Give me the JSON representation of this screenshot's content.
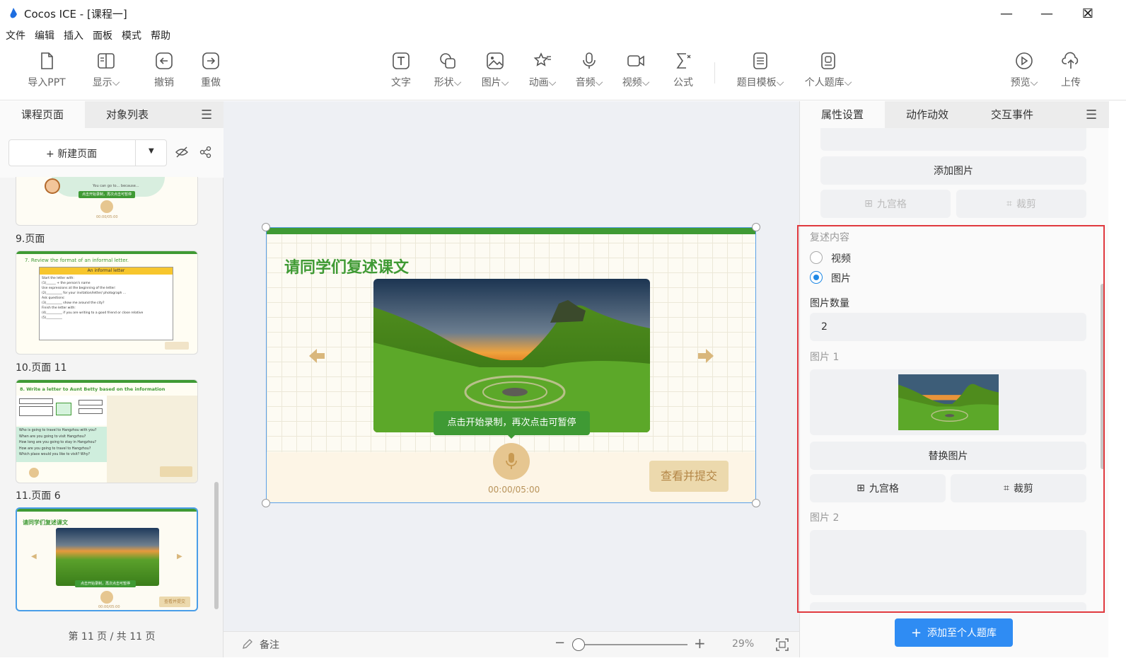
{
  "window": {
    "title": "Cocos ICE - [课程一]",
    "minimize": "—",
    "maximize": "☐",
    "close": "✕"
  },
  "menu": [
    "文件",
    "编辑",
    "插入",
    "面板",
    "模式",
    "帮助"
  ],
  "toolbar": {
    "import_ppt": "导入PPT",
    "display": "显示",
    "undo": "撤销",
    "redo": "重做",
    "text": "文字",
    "shape": "形状",
    "image": "图片",
    "animation": "动画",
    "audio": "音频",
    "video": "视频",
    "formula": "公式",
    "question_template": "题目模板",
    "personal_bank": "个人题库",
    "preview": "预览",
    "upload": "上传"
  },
  "left_panel": {
    "tabs": [
      "课程页面",
      "对象列表"
    ],
    "new_page": "新建页面",
    "pages": [
      {
        "label": "9.页面",
        "line1": "You can go to... because...",
        "rec_btn": "点击开始录制，再次点击可暂停",
        "time": "00:00/05:00"
      },
      {
        "label": "10.页面 11",
        "heading": "7. Review the format of an informal letter.",
        "box_title": "An informal letter",
        "lines": [
          "Start the letter with:",
          "Use expressions at the beginning of the letter:",
          "Ask questions:",
          "Finish the letter with:"
        ],
        "bullets": [
          "(1)______ + the person's name",
          "(2)__________ for your invitation/letter/ photograph ...",
          "(3)__________ show me around the city?",
          "(4)__________ if you are writing to a good friend or close relative",
          "(5)__________"
        ]
      },
      {
        "label": "11.页面 6",
        "heading": "8. Write a letter to Aunt Betty based on the information",
        "questions": [
          "Who is going to travel to Hangzhou with you?",
          "When are you going to visit Hangzhou?",
          "How long are you going to stay in Hangzhou?",
          "How are you going to travel to Hangzhou?",
          "Which place would you like to visit? Why?"
        ]
      },
      {
        "label": "",
        "title": "请同学们复述课文",
        "rec_btn": "点击开始录制，再次点击可暂停",
        "time": "00:00/05:00",
        "submit": "查看并提交"
      }
    ],
    "pagination": "第 11 页 / 共 11 页"
  },
  "slide": {
    "title": "请同学们复述课文",
    "record_tip": "点击开始录制，再次点击可暂停",
    "timer": "00:00/05:00",
    "submit": "查看并提交"
  },
  "bottom_bar": {
    "notes": "备注",
    "zoom": "29%",
    "zoom_level": 0.29
  },
  "right_panel": {
    "tabs": [
      "属性设置",
      "动作动效",
      "交互事件"
    ],
    "add_image": "添加图片",
    "nine_grid": "九宫格",
    "crop": "裁剪",
    "retell_content": "复述内容",
    "option_video": "视频",
    "option_image": "图片",
    "image_count_label": "图片数量",
    "image_count": "2",
    "image1": "图片 1",
    "replace_image": "替换图片",
    "image2": "图片 2",
    "add_to_bank": "添加至个人题库"
  },
  "colors": {
    "accent_green": "#3f9a34",
    "highlight_red": "#e0393e",
    "primary_blue": "#2f8cf3",
    "mic_tan": "#e6c690"
  }
}
